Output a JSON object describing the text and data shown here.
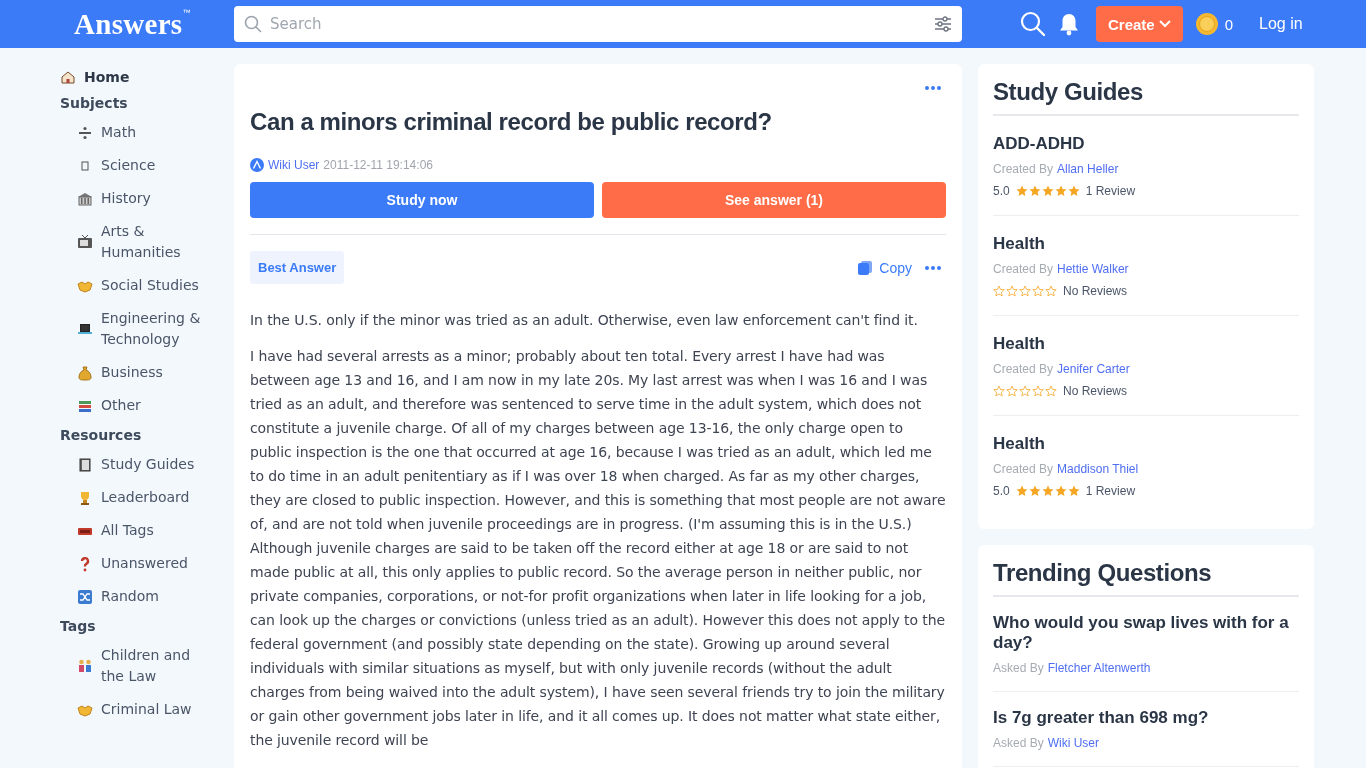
{
  "header": {
    "logo": "Answers",
    "logo_mark": "™",
    "search": {
      "placeholder": "Search"
    },
    "create_button": "Create",
    "coins": "0",
    "login": "Log in"
  },
  "sidebar": {
    "sections": [
      {
        "kind": "link",
        "label": "Home"
      },
      {
        "kind": "heading",
        "label": "Subjects",
        "items": [
          "Math",
          "Science",
          "History",
          "Arts & Humanities",
          "Social Studies",
          "Engineering & Technology",
          "Business",
          "Other"
        ]
      },
      {
        "kind": "heading",
        "label": "Resources",
        "items": [
          "Study Guides",
          "Leaderboard",
          "All Tags",
          "Unanswered",
          "Random"
        ]
      },
      {
        "kind": "heading",
        "label": "Tags",
        "items": [
          "Children and the Law",
          "Criminal Law"
        ]
      }
    ]
  },
  "question": {
    "title": "Can a minors criminal record be public record?",
    "author": "Wiki User",
    "date": "2011-12-11 19:14:06",
    "buttons": [
      {
        "kind": "primary",
        "label": "Study now"
      },
      {
        "kind": "accent",
        "label": "See answer (1)"
      }
    ],
    "answer": {
      "badge": "Best Answer",
      "copy": "Copy",
      "paragraphs": [
        "In the U.S. only if the minor was tried as an adult. Otherwise, even law enforcement can't find it.",
        "I have had several arrests as a minor; probably about ten total. Every arrest I have had was between age 13 and 16, and I am now in my late 20s. My last arrest was when I was 16 and I was tried as an adult, and therefore was sentenced to serve time in the adult system, which does not constitute a juvenile charge. Of all of my charges between age 13-16, the only charge open to public inspection is the one that occurred at age 16, because I was tried as an adult, which led me to do time in an adult penitentiary as if I was over 18 when charged. As far as my other charges, they are closed to public inspection. However, and this is something that most people are not aware of, and are not told when juvenile proceedings are in progress. (I'm assuming this is in the U.S.) Although juvenile charges are said to be taken off the record either at age 18 or are said to not made public at all, this only applies to public record. So the average person in neither public, nor private companies, corporations, or not-for profit organizations when later in life looking for a job, can look up the charges or convictions (unless tried as an adult). However this does not apply to the federal government (and possibly state depending on the state). Growing up around several individuals with similar situations as myself, but with only juvenile records (without the adult charges from being waived into the adult system), I have seen several friends try to join the military or gain other government jobs later in life, and it all comes up. It does not matter what state either, the juvenile record will be"
      ]
    }
  },
  "study_guides": {
    "title": "Study Guides",
    "items": [
      {
        "title": "ADD-ADHD",
        "created_by_label": "Created By",
        "author": "Allan Heller",
        "rating": "5.0",
        "stars": 5,
        "reviews": "1 Review"
      },
      {
        "title": "Health",
        "created_by_label": "Created By",
        "author": "Hettie Walker",
        "stars": 0,
        "reviews": "No Reviews"
      },
      {
        "title": "Health",
        "created_by_label": "Created By",
        "author": "Jenifer Carter",
        "stars": 0,
        "reviews": "No Reviews"
      },
      {
        "title": "Health",
        "created_by_label": "Created By",
        "author": "Maddison Thiel",
        "rating": "5.0",
        "stars": 5,
        "reviews": "1 Review"
      }
    ]
  },
  "trending": {
    "title": "Trending Questions",
    "items": [
      {
        "question": "Who would you swap lives with for a day?",
        "asked_by_label": "Asked By",
        "author": "Fletcher Altenwerth"
      },
      {
        "question": "Is 7g greater than 698 mg?",
        "asked_by_label": "Asked By",
        "author": "Wiki User"
      }
    ]
  }
}
